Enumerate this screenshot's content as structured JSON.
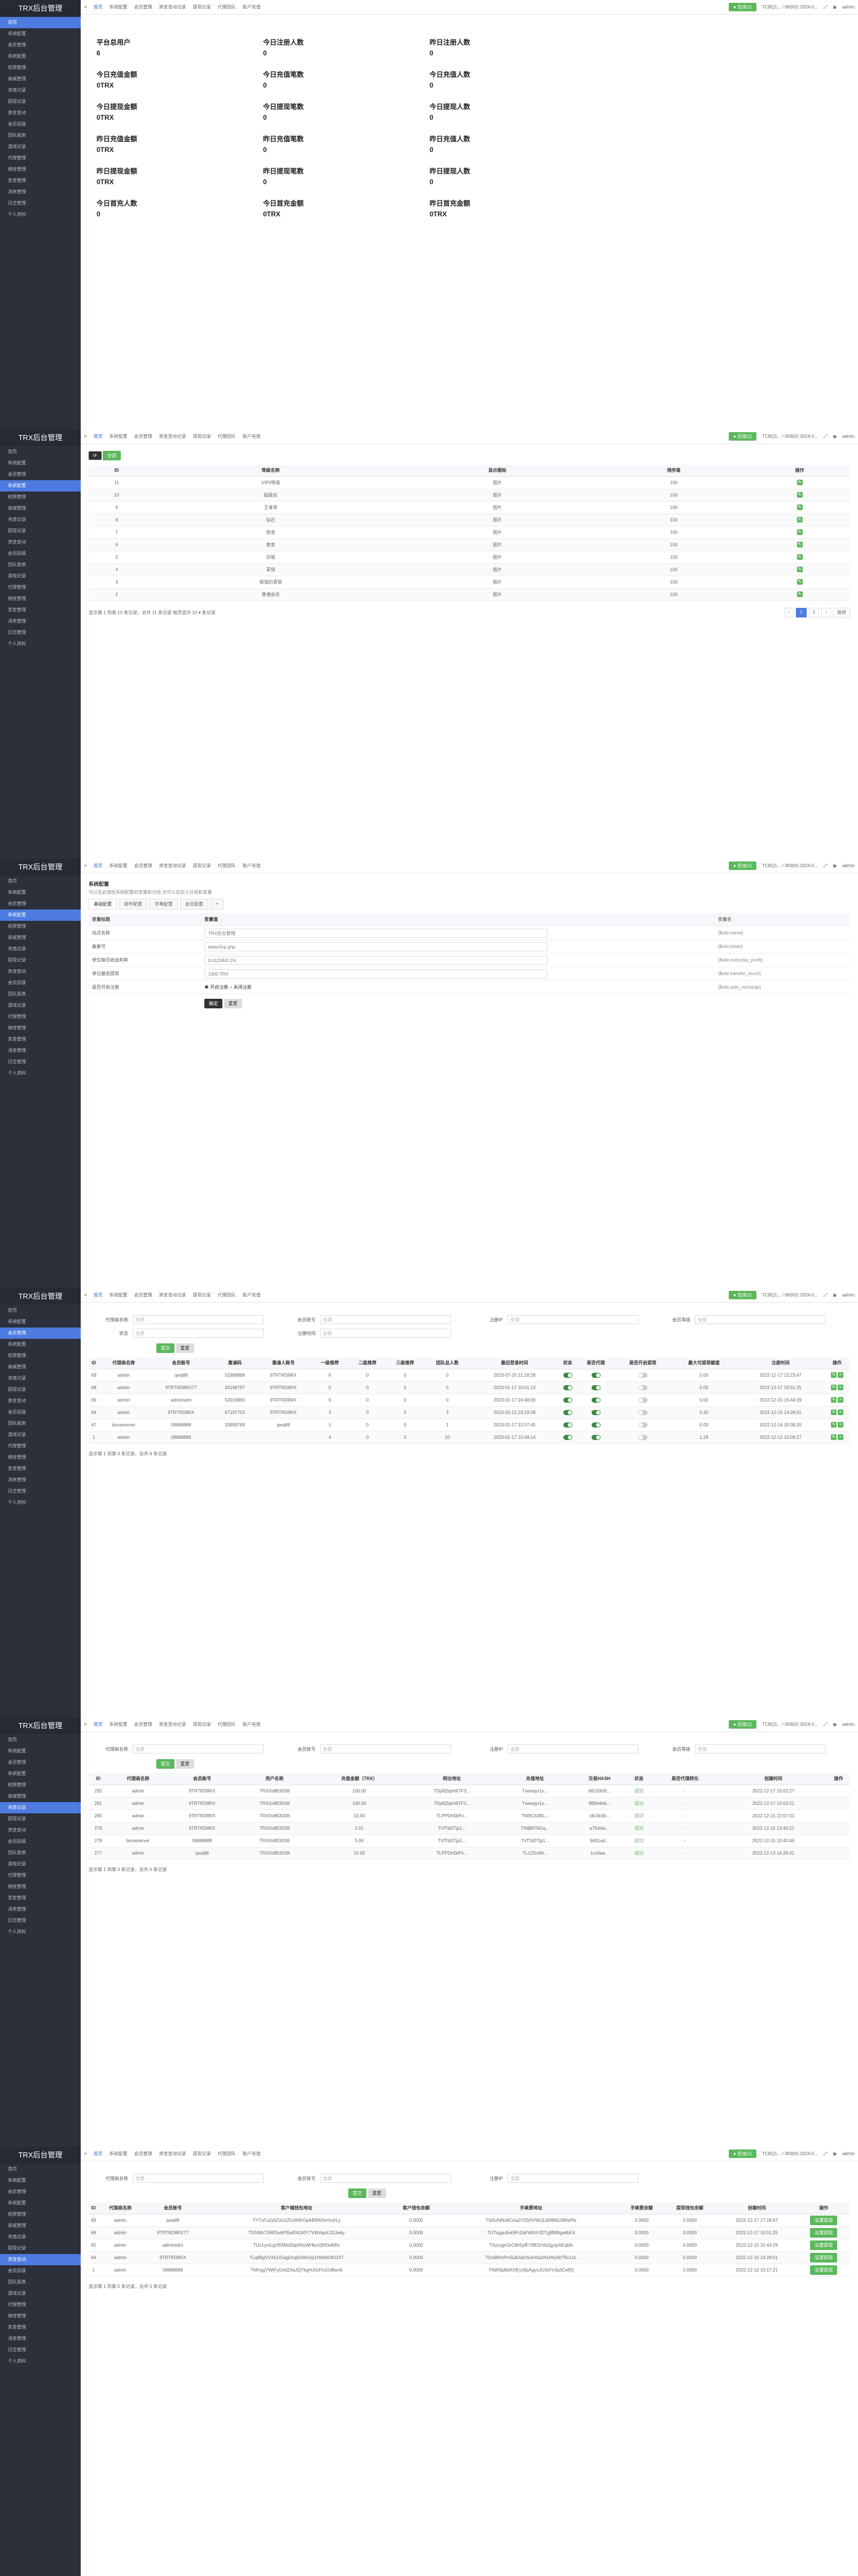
{
  "app": {
    "title": "TRX后台管理"
  },
  "top": {
    "tabs": [
      "首页",
      "系统配置",
      "会员管理",
      "资金变动记录",
      "提现记录",
      "代理团队",
      "账户充值"
    ],
    "status_btn": "● 在线(1)",
    "status_info": "TCBQ1... / 0KB(0) 2024-0...",
    "user": "admin"
  },
  "sidebar": {
    "menu": [
      "首页",
      "系统配置",
      "会员管理",
      "系统配置",
      "权限管理",
      "商城管理",
      "充值记录",
      "提现记录",
      "资金变动",
      "会员层级",
      "团队报表",
      "游戏记录",
      "代理管理",
      "佣金管理",
      "奖金管理",
      "消息管理",
      "日志管理",
      "个人资料"
    ]
  },
  "dashboard": {
    "stats": [
      {
        "k": "平台总用户",
        "v": "6"
      },
      {
        "k": "今日注册人数",
        "v": "0"
      },
      {
        "k": "昨日注册人数",
        "v": "0"
      },
      {
        "k": "今日充值金额",
        "v": "0TRX"
      },
      {
        "k": "今日充值笔数",
        "v": "0"
      },
      {
        "k": "今日充值人数",
        "v": "0"
      },
      {
        "k": "今日提现金额",
        "v": "0TRX"
      },
      {
        "k": "今日提现笔数",
        "v": "0"
      },
      {
        "k": "今日提现人数",
        "v": "0"
      },
      {
        "k": "昨日充值金额",
        "v": "0TRX"
      },
      {
        "k": "昨日充值笔数",
        "v": "0"
      },
      {
        "k": "昨日充值人数",
        "v": "0"
      },
      {
        "k": "昨日提现金额",
        "v": "0TRX"
      },
      {
        "k": "昨日提现笔数",
        "v": "0"
      },
      {
        "k": "昨日提现人数",
        "v": "0"
      },
      {
        "k": "今日首充人数",
        "v": "0"
      },
      {
        "k": "今日首充金额",
        "v": "0TRX"
      },
      {
        "k": "昨日首充金额",
        "v": "0TRX"
      }
    ]
  },
  "levels": {
    "headers": [
      "ID",
      "等级名称",
      "显示图标",
      "排序值",
      "操作"
    ],
    "rows": [
      [
        "11",
        "VIP0等级",
        "图片",
        "100"
      ],
      [
        "10",
        "超级玩",
        "图片",
        "100"
      ],
      [
        "9",
        "王者等",
        "图片",
        "100"
      ],
      [
        "8",
        "钻石",
        "图片",
        "100"
      ],
      [
        "7",
        "铂金",
        "图片",
        "100"
      ],
      [
        "6",
        "黄金",
        "图片",
        "100"
      ],
      [
        "5",
        "白银",
        "图片",
        "100"
      ],
      [
        "4",
        "青铜",
        "图片",
        "100"
      ],
      [
        "3",
        "倔强的青铜",
        "图片",
        "100"
      ],
      [
        "2",
        "普通会员",
        "图片",
        "100"
      ]
    ],
    "footer": "显示第 1 到第 10 条记录，总共 11 条记录 每页显示 10 ▾ 条记录",
    "pages": [
      "‹",
      "1",
      "2",
      "›"
    ],
    "goto": "跳转"
  },
  "config": {
    "title": "系统配置",
    "note": "可以在此增改系统配置的变量和分组,也可以自定义分组和变量",
    "tabs": [
      "基础配置",
      "邮件配置",
      "字典配置",
      "会员配置",
      "+"
    ],
    "headers": [
      "变量标题",
      "变量值",
      "变量名"
    ],
    "rows": [
      [
        "站点名称",
        "TRX后台管理",
        "{$site.name}"
      ],
      [
        "备案号",
        "beian/icp.php",
        "{$site.beian}"
      ],
      [
        "单位每日收益利率",
        "0.01234/0.1%",
        "{$site.everyday_profit}"
      ],
      [
        "单位最低提现",
        "1000 TRX",
        "{$site.transfer_touch}"
      ],
      [
        "是否开启注册",
        "开启注册",
        "{$site.auto_recharge}"
      ]
    ],
    "radio_on": "开启注册",
    "radio_off": "关闭注册",
    "ok": "确定",
    "reset": "重置"
  },
  "members": {
    "filters": [
      "代理商名称",
      "会员账号",
      "注册IP",
      "会员等级",
      "状态",
      "注册时间"
    ],
    "headers": [
      "ID",
      "代理商名称",
      "会员账号",
      "邀请码",
      "邀请人账号",
      "一级推荐",
      "二级推荐",
      "三级推荐",
      "团队总人数",
      "最后登录时间",
      "状态",
      "是否代理",
      "是否开启提现",
      "最大可提现额度",
      "注册时间",
      "操作"
    ],
    "rows": [
      [
        "69",
        "admin",
        "qwq88",
        "51889888",
        "9TRTRD8RX",
        "0",
        "0",
        "0",
        "0",
        "2023-07-25 21:18:28",
        "",
        "",
        "",
        "0.00",
        "2022-12-17 12:23:47"
      ],
      [
        "68",
        "admin",
        "9TRTRD8RX77",
        "33198797",
        "9TRTRD8RX",
        "0",
        "0",
        "0",
        "0",
        "2023-01-17 10:01:13",
        "",
        "",
        "",
        "0.00",
        "2022-12-17 10:51:25"
      ],
      [
        "65",
        "admin",
        "adminsdm",
        "53016860",
        "9TRTRD8RX",
        "0",
        "0",
        "0",
        "0",
        "2023-01-17 16:48:09",
        "",
        "",
        "",
        "0.00",
        "2022-12-15 15:44:29"
      ],
      [
        "64",
        "admin",
        "9TRTRD8RX",
        "67197753",
        "9TRTRD8RX",
        "3",
        "0",
        "0",
        "3",
        "2023-02-12 23:19:29",
        "",
        "",
        "",
        "0.42",
        "2022-12-15 14:28:01"
      ],
      [
        "67",
        "bonaiserver",
        "08888888",
        "33999789",
        "qwq88",
        "1",
        "0",
        "0",
        "1",
        "2023-01-17 22:07:45",
        "",
        "",
        "",
        "0.00",
        "2022-12-16 20:38:20"
      ],
      [
        "1",
        "admin",
        "08888888",
        "",
        "",
        "4",
        "0",
        "0",
        "10",
        "2023-01-17 10:49:14",
        "",
        "",
        "",
        "1.29",
        "2022-12-12 10:09:27"
      ]
    ],
    "footer": "显示第 1 到第 6 条记录，总共 6 条记录"
  },
  "recharge": {
    "headers": [
      "ID",
      "代理商名称",
      "会员账号",
      "用户名称",
      "充值金额（TRX）",
      "转出地址",
      "充值地址",
      "交易HASH",
      "状态",
      "是否代理转化",
      "创建时间",
      "操作"
    ],
    "rows": [
      [
        "292",
        "admin",
        "9TRTRD8RX",
        "TRX0x8B3D08",
        "100.00",
        "TDp8ZbpH6TF3...",
        "Txewqyr1o...",
        "6B19309...",
        "成功",
        "-",
        "2022-12-17 15:02:27"
      ],
      [
        "291",
        "admin",
        "9TRTRD8RX",
        "TRX0x8B3D08",
        "100.00",
        "TDp8ZbpH6TF3...",
        "Txewqyr1o...",
        "9B9e9eb...",
        "成功",
        "-",
        "2022-12-17 15:03:21"
      ],
      [
        "285",
        "admin",
        "9TRTRD8RX",
        "TRX0x8B3D08",
        "10.00",
        "TLPPDh5bPx...",
        "TNt9Cb3B1...",
        "c8c3b3b...",
        "成功",
        "-",
        "2022-12-15 22:07:01"
      ],
      [
        "279",
        "admin",
        "9TRTRD8RX",
        "TRX0x8B3D08",
        "2.01",
        "TVfTbDTjp1...",
        "TN8jRFNGq...",
        "a7fcb0a...",
        "成功",
        "-",
        "2022-12-15 13:40:21"
      ],
      [
        "278",
        "bonaiserver",
        "08888888",
        "TRX0x8B3D08",
        "5.00",
        "TVfTbDTjp1...",
        "TVfTbDTjp1...",
        "9d51ad...",
        "成功",
        "-",
        "2022-12-15 10:40:44"
      ],
      [
        "277",
        "admin",
        "qwq88",
        "TRX0x8B3D08",
        "10.00",
        "TLPPDh5bPx...",
        "TL1Z5n4N...",
        "1cc6aa...",
        "成功",
        "-",
        "2022-12-13 14:28:41"
      ]
    ],
    "footer": "显示第 1 到第 6 条记录，总共 6 条记录"
  },
  "addresses": {
    "headers": [
      "ID",
      "代理商名称",
      "会员账号",
      "客户端钱包地址",
      "客户钱包余额",
      "手续费地址",
      "手续费余额",
      "提现钱包余额",
      "创建时间",
      "操作"
    ],
    "rows": [
      [
        "69",
        "admin",
        "qwq88",
        "TYTxFu2y6ZoUzZhzW9rGpikB8W3mXuhLy",
        "0.0000",
        "TSAUNNc8Czia2V3SHVWiJLbN9MU3WsPbr",
        "0.0000",
        "0.0000",
        "2022-12-17 17:18:47"
      ],
      [
        "68",
        "admin",
        "9TRTRD8RX77",
        "TD5Wh7JHR3ubPt5wD4Gt0Y7VWxbpXJ2Uwky",
        "0.0000",
        "TUTxgqu9vk9FrZqFWbVrJDTg8fM9ga4bFd",
        "0.0000",
        "0.0000",
        "2022-12-17 10:51:25"
      ],
      [
        "65",
        "admin",
        "adminsdm",
        "TUz1ymLgVB3Md2bp5NyWHkuVjfrEk4Mhr",
        "0.0000",
        "TVyyuge3zC8h5pfFY8ESrVa2gyqchEqbfo",
        "0.0000",
        "0.0000",
        "2022-12-15 15:44:29"
      ],
      [
        "64",
        "admin",
        "9TRTRD8RX",
        "TLq89gVVXk1rGqgOvg5hWvUp1HhbW3KDXT",
        "0.0000",
        "TDoMIhtrPoSu8JdmSohXbutXvHhyW7Rc1nL",
        "0.0000",
        "0.0000",
        "2022-12-15 14:28:01"
      ],
      [
        "1",
        "admin",
        "08888888",
        "TMVggYWtFyG4dZ4aJQYkgHJG9Yu5UBwn6",
        "0.0000",
        "TNWSpBdXHEyz9pAgyoJU3zFn3q3Ce8Q",
        "0.0000",
        "0.0000",
        "2022-12-12 10:17:21"
      ]
    ],
    "action": "设置提现",
    "footer": "显示第 1 到第 5 条记录，总共 5 条记录"
  },
  "common": {
    "search": "提交",
    "reset": "重置",
    "select_all": "全部"
  }
}
